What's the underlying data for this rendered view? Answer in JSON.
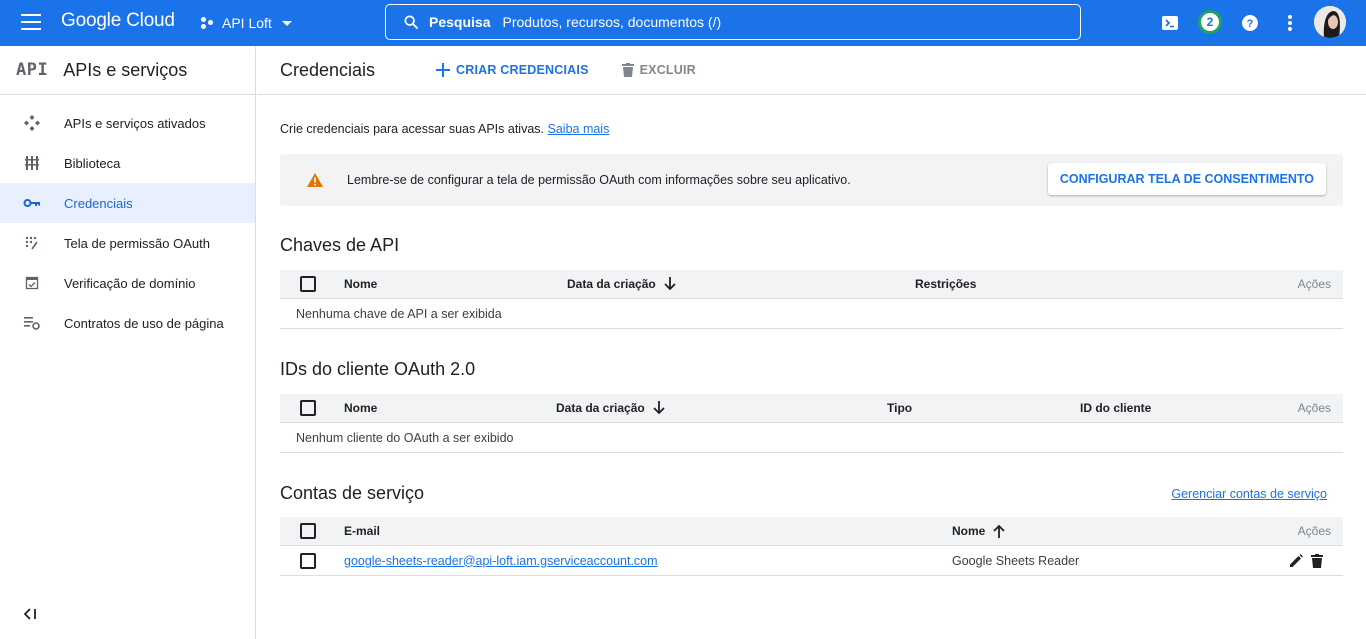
{
  "topbar": {
    "logo": "Google Cloud",
    "project": "API Loft",
    "search_label": "Pesquisa",
    "search_placeholder": "Produtos, recursos, documentos (/)",
    "notifications_count": "2",
    "icons": [
      "menu-icon",
      "project-icon",
      "search-icon",
      "cloud-shell-icon",
      "help-icon",
      "more-vert-icon",
      "avatar"
    ],
    "brand_color": "#1a73e8"
  },
  "sidebar": {
    "logo": "API",
    "title": "APIs e serviços",
    "items": [
      {
        "label": "APIs e serviços ativados",
        "icon": "apis-icon",
        "active": false
      },
      {
        "label": "Biblioteca",
        "icon": "library-icon",
        "active": false
      },
      {
        "label": "Credenciais",
        "icon": "key-icon",
        "active": true
      },
      {
        "label": "Tela de permissão OAuth",
        "icon": "oauth-icon",
        "active": false
      },
      {
        "label": "Verificação de domínio",
        "icon": "domain-check-icon",
        "active": false
      },
      {
        "label": "Contratos de uso de página",
        "icon": "page-settings-icon",
        "active": false
      }
    ]
  },
  "header": {
    "title": "Credenciais",
    "create_label": "CRIAR CREDENCIAIS",
    "delete_label": "EXCLUIR"
  },
  "intro": {
    "text": "Crie credenciais para acessar suas APIs ativas.",
    "link": "Saiba mais"
  },
  "banner": {
    "text": "Lembre-se de configurar a tela de permissão OAuth com informações sobre seu aplicativo.",
    "button": "CONFIGURAR TELA DE CONSENTIMENTO",
    "warn_color": "#e37400"
  },
  "api_keys": {
    "title": "Chaves de API",
    "columns": [
      "Nome",
      "Data da criação",
      "Restrições",
      "Ações"
    ],
    "empty": "Nenhuma chave de API a ser exibida"
  },
  "oauth": {
    "title": "IDs do cliente OAuth 2.0",
    "columns": [
      "Nome",
      "Data da criação",
      "Tipo",
      "ID do cliente",
      "Ações"
    ],
    "empty": "Nenhum cliente do OAuth a ser exibido"
  },
  "service_accounts": {
    "title": "Contas de serviço",
    "manage_link": "Gerenciar contas de serviço",
    "columns": [
      "E-mail",
      "Nome",
      "Ações"
    ],
    "rows": [
      {
        "email": "google-sheets-reader@api-loft.iam.gserviceaccount.com",
        "name": "Google Sheets Reader"
      }
    ]
  }
}
